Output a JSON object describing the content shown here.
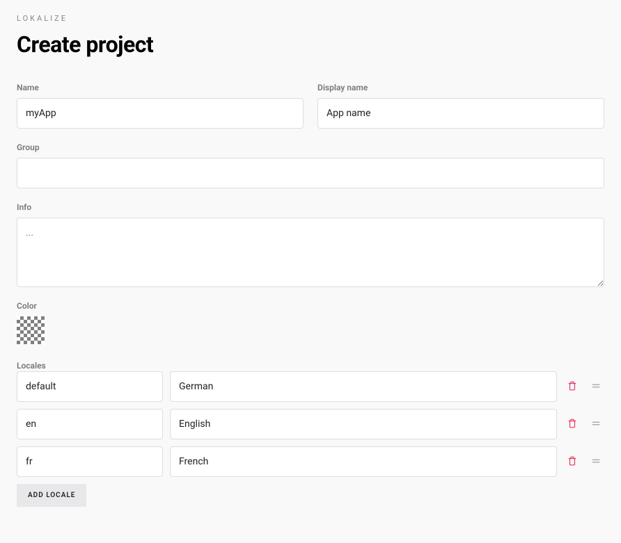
{
  "breadcrumb": "LOKALIZE",
  "page_title": "Create project",
  "fields": {
    "name": {
      "label": "Name",
      "placeholder": "myApp",
      "value": ""
    },
    "display_name": {
      "label": "Display name",
      "placeholder": "App name",
      "value": ""
    },
    "group": {
      "label": "Group",
      "value": ""
    },
    "info": {
      "label": "Info",
      "placeholder": "...",
      "value": ""
    },
    "color": {
      "label": "Color"
    },
    "locales": {
      "label": "Locales",
      "rows": [
        {
          "code": "default",
          "name": "German"
        },
        {
          "code": "en",
          "name": "English"
        },
        {
          "code": "fr",
          "name": "French"
        }
      ],
      "add_label": "ADD LOCALE"
    }
  }
}
